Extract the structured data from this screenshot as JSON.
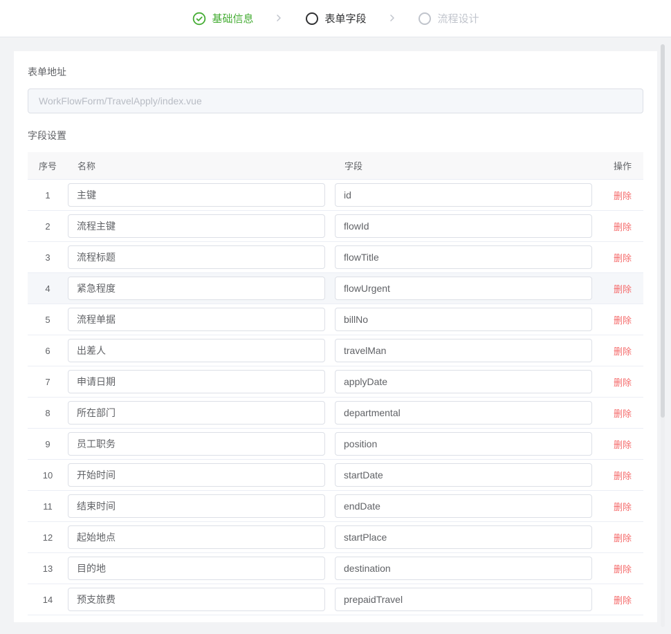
{
  "steps": {
    "completed": "基础信息",
    "current": "表单字段",
    "pending": "流程设计"
  },
  "section": {
    "formAddressLabel": "表单地址",
    "formAddressValue": "WorkFlowForm/TravelApply/index.vue",
    "fieldSettingLabel": "字段设置"
  },
  "table": {
    "headers": {
      "idx": "序号",
      "name": "名称",
      "field": "字段",
      "act": "操作"
    },
    "deleteLabel": "删除",
    "rows": [
      {
        "idx": "1",
        "name": "主键",
        "field": "id"
      },
      {
        "idx": "2",
        "name": "流程主键",
        "field": "flowId"
      },
      {
        "idx": "3",
        "name": "流程标题",
        "field": "flowTitle"
      },
      {
        "idx": "4",
        "name": "紧急程度",
        "field": "flowUrgent",
        "active": true
      },
      {
        "idx": "5",
        "name": "流程单据",
        "field": "billNo"
      },
      {
        "idx": "6",
        "name": "出差人",
        "field": "travelMan"
      },
      {
        "idx": "7",
        "name": "申请日期",
        "field": "applyDate"
      },
      {
        "idx": "8",
        "name": "所在部门",
        "field": "departmental"
      },
      {
        "idx": "9",
        "name": "员工职务",
        "field": "position"
      },
      {
        "idx": "10",
        "name": "开始时间",
        "field": "startDate"
      },
      {
        "idx": "11",
        "name": "结束时间",
        "field": "endDate"
      },
      {
        "idx": "12",
        "name": "起始地点",
        "field": "startPlace"
      },
      {
        "idx": "13",
        "name": "目的地",
        "field": "destination"
      },
      {
        "idx": "14",
        "name": "预支旅费",
        "field": "prepaidTravel"
      }
    ]
  }
}
